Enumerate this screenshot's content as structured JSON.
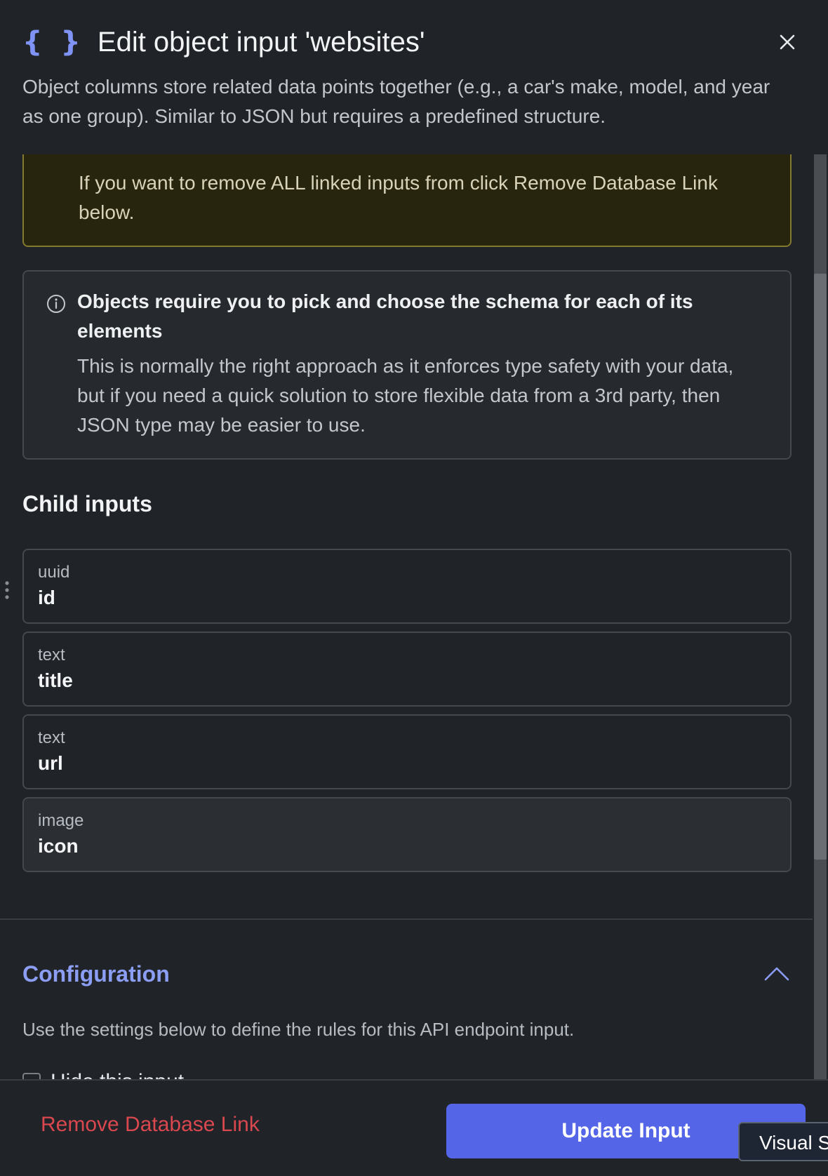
{
  "dialog": {
    "title": "Edit object input 'websites'",
    "description": "Object columns store related data points together (e.g., a car's make, model, and year as one group). Similar to JSON but requires a predefined structure."
  },
  "warning": {
    "text": "If you want to remove ALL linked inputs from click Remove Database Link below."
  },
  "info": {
    "title": "Objects require you to pick and choose the schema for each of its elements",
    "body": "This is normally the right approach as it enforces type safety with your data, but if you need a quick solution to store flexible data from a 3rd party, then JSON type may be easier to use."
  },
  "child_inputs": {
    "heading": "Child inputs",
    "items": [
      {
        "type": "uuid",
        "name": "id"
      },
      {
        "type": "text",
        "name": "title"
      },
      {
        "type": "text",
        "name": "url"
      },
      {
        "type": "image",
        "name": "icon"
      }
    ]
  },
  "configuration": {
    "title": "Configuration",
    "description": "Use the settings below to define the rules for this API endpoint input.",
    "hide_label": "Hide this input"
  },
  "footer": {
    "remove_label": "Remove Database Link",
    "update_label": "Update Input",
    "visual_tag": "Visual S"
  },
  "colors": {
    "accent": "#5565e8",
    "danger": "#d9474f",
    "link": "#8c9df4",
    "background": "#202327"
  }
}
